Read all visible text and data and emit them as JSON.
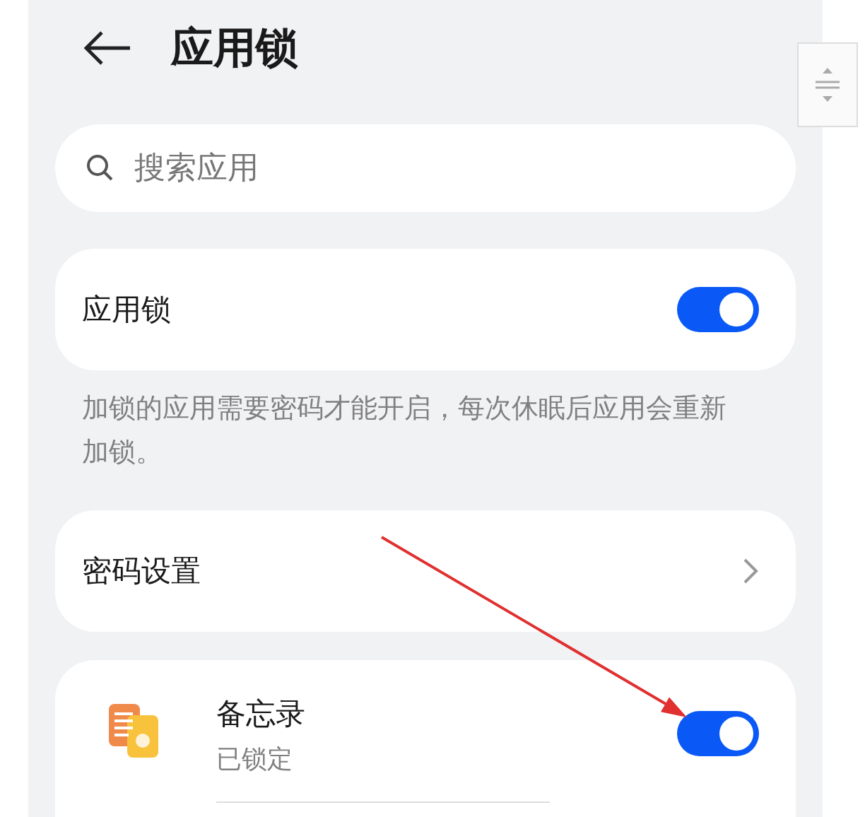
{
  "header": {
    "title": "应用锁"
  },
  "search": {
    "placeholder": "搜索应用"
  },
  "app_lock": {
    "label": "应用锁",
    "on": true
  },
  "description": "加锁的应用需要密码才能开启，每次休眠后应用会重新加锁。",
  "password_settings": {
    "label": "密码设置"
  },
  "apps": [
    {
      "name": "备忘录",
      "status": "已锁定",
      "on": true
    }
  ]
}
